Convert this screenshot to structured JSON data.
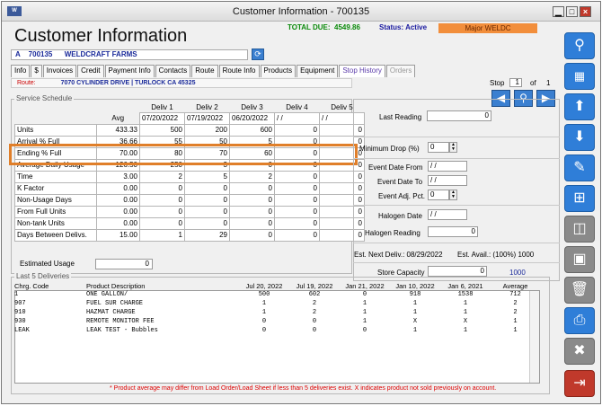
{
  "window": {
    "title": "Customer Information - 700135",
    "app_logo": "W"
  },
  "header": {
    "total_due_label": "TOTAL DUE:",
    "total_due": "4549.86",
    "status_label": "Status:",
    "status": "Active",
    "badge": "Major WELDC",
    "page_title": "Customer Information"
  },
  "customer": {
    "type": "A",
    "id": "700135",
    "name": "WELDCRAFT FARMS"
  },
  "tabs": [
    {
      "label": "Info"
    },
    {
      "label": "$"
    },
    {
      "label": "Invoices"
    },
    {
      "label": "Credit"
    },
    {
      "label": "Payment Info"
    },
    {
      "label": "Contacts"
    },
    {
      "label": "Route"
    },
    {
      "label": "Route Info"
    },
    {
      "label": "Products"
    },
    {
      "label": "Equipment"
    },
    {
      "label": "Stop History",
      "state": "active"
    },
    {
      "label": "Orders",
      "state": "disabled"
    }
  ],
  "route": {
    "label": "Route:",
    "address": "7070 CYLINDER DRIVE | TURLOCK CA 45325"
  },
  "stop": {
    "label": "Stop",
    "current": "1",
    "of_label": "of",
    "total": "1"
  },
  "service_schedule": {
    "title": "Service Schedule",
    "avg_label": "Avg",
    "deliv_headers": [
      "Deliv 1",
      "Deliv 2",
      "Deliv 3",
      "Deliv 4",
      "Deliv 5"
    ],
    "dates": [
      "07/20/2022",
      "07/19/2022",
      "06/20/2022",
      "/ /",
      "/ /"
    ],
    "rows": [
      {
        "label": "Units",
        "avg": "433.33",
        "vals": [
          "500",
          "200",
          "600",
          "0",
          "0"
        ]
      },
      {
        "label": "Arrival % Full",
        "avg": "36.66",
        "vals": [
          "55",
          "50",
          "5",
          "0",
          "0"
        ]
      },
      {
        "label": "Ending % Full",
        "avg": "70.00",
        "vals": [
          "80",
          "70",
          "60",
          "0",
          "0"
        ]
      },
      {
        "label": "Average Daily Usage",
        "avg": "126.50",
        "vals": [
          "250",
          "3",
          "0",
          "0",
          "0"
        ]
      },
      {
        "label": "Time",
        "avg": "3.00",
        "vals": [
          "2",
          "5",
          "2",
          "0",
          "0"
        ]
      },
      {
        "label": "K Factor",
        "avg": "0.00",
        "vals": [
          "0",
          "0",
          "0",
          "0",
          "0"
        ]
      },
      {
        "label": "Non-Usage Days",
        "avg": "0.00",
        "vals": [
          "0",
          "0",
          "0",
          "0",
          "0"
        ]
      },
      {
        "label": "From Full Units",
        "avg": "0.00",
        "vals": [
          "0",
          "0",
          "0",
          "0",
          "0"
        ]
      },
      {
        "label": "Non-tank Units",
        "avg": "0.00",
        "vals": [
          "0",
          "0",
          "0",
          "0",
          "0"
        ]
      },
      {
        "label": "Days Between Delivs.",
        "avg": "15.00",
        "vals": [
          "1",
          "29",
          "0",
          "0",
          "0"
        ]
      }
    ],
    "estimated_usage_label": "Estimated Usage",
    "estimated_usage": "0"
  },
  "right_panel": {
    "last_reading_label": "Last Reading",
    "last_reading": "0",
    "min_drop_label": "Minimum Drop (%)",
    "min_drop": "0",
    "event_from_label": "Event Date From",
    "event_from": "/ /",
    "event_to_label": "Event Date To",
    "event_to": "/ /",
    "event_adj_label": "Event Adj. Pct.",
    "event_adj": "0",
    "halogen_date_label": "Halogen Date",
    "halogen_date": "/ /",
    "halogen_reading_label": "Halogen Reading",
    "halogen_reading": "0",
    "est_next_deliv": "Est. Next Deliv.: 08/29/2022",
    "est_avail": "Est. Avail.: (100%) 1000",
    "store_capacity_label": "Store Capacity",
    "store_capacity": "0",
    "store_capacity_value": "1000"
  },
  "last_deliveries": {
    "title": "Last 5 Deliveries",
    "headers": [
      "Chrg. Code",
      "Product Description",
      "Jul 20, 2022",
      "Jul 19, 2022",
      "Jan 21, 2022",
      "Jan 10, 2022",
      "Jan 6, 2021",
      "Average"
    ],
    "rows": [
      [
        "1",
        "ONE GALLON/",
        "500",
        "602",
        "0",
        "918",
        "1538",
        "712"
      ],
      [
        "907",
        "FUEL SUR CHARGE",
        "1",
        "2",
        "1",
        "1",
        "1",
        "2"
      ],
      [
        "910",
        "HAZMAT CHARGE",
        "1",
        "2",
        "1",
        "1",
        "1",
        "2"
      ],
      [
        "930",
        "REMOTE MONITOR FEE",
        "0",
        "0",
        "1",
        "X",
        "X",
        "1"
      ],
      [
        "LEAK",
        "LEAK TEST - Bubbles",
        "0",
        "0",
        "0",
        "1",
        "1",
        "1"
      ]
    ],
    "footnote": "* Product average may differ from Load Order/Load Sheet if less than 5 deliveries exist. X indicates product not sold previously on account."
  },
  "sidebar_icons": [
    "search-icon",
    "grid-icon",
    "arrow-up-icon",
    "arrow-down-icon",
    "edit-icon",
    "new-document-icon",
    "save-new-icon",
    "save-icon",
    "trash-icon",
    "print-icon",
    "close-icon",
    "exit-icon"
  ],
  "colors": {
    "accent": "#2f7ed8",
    "highlight": "#e07f2a",
    "badge": "#f28e3b",
    "total_due": "#0a8a0a"
  }
}
